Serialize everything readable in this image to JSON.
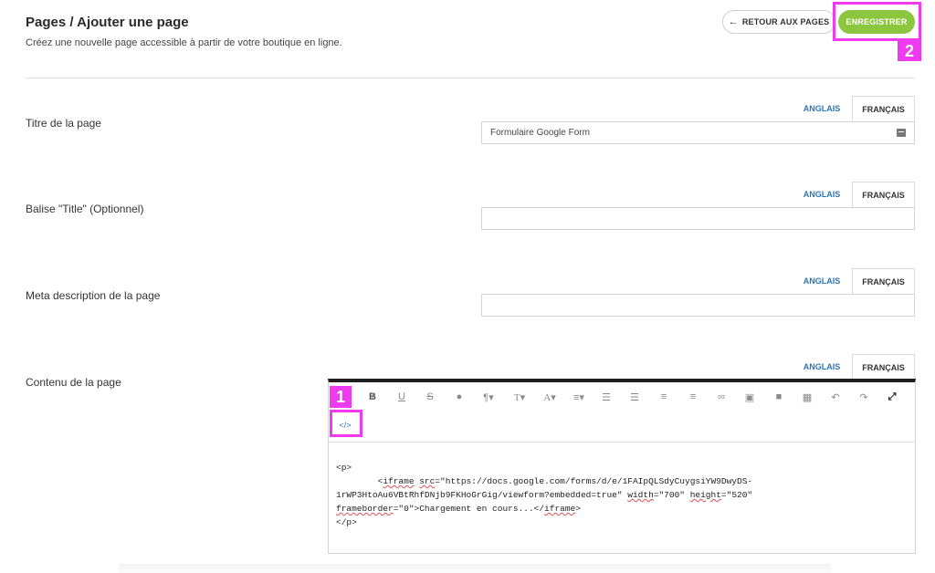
{
  "header": {
    "title": "Pages / Ajouter une page",
    "subtitle": "Créez une nouvelle page accessible à partir de votre boutique en ligne.",
    "back_label": "RETOUR AUX PAGES",
    "save_label": "ENREGISTRER"
  },
  "badges": {
    "one": "1",
    "two": "2"
  },
  "languages": {
    "en": "ANGLAIS",
    "fr": "FRANÇAIS"
  },
  "fields": {
    "page_title": {
      "label": "Titre de la page",
      "value": "Formulaire Google Form"
    },
    "title_tag": {
      "label": "Balise \"Title\" (Optionnel)",
      "value": ""
    },
    "meta_description": {
      "label": "Meta description de la page",
      "value": ""
    },
    "content": {
      "label": "Contenu de la page"
    }
  },
  "editor": {
    "code": {
      "line1": "<p>",
      "line2_indent": "        <",
      "line2_tag": "iframe",
      "line2_sp": " ",
      "line2_attr": "src",
      "line2_rest": "=\"https://docs.google.com/forms/d/e/1FAIpQLSdyCuygsiYW9DwyDS-",
      "line3": "1rWP3HtoAu6VBtRhfDNjb9FKHoGrGig/viewform?embedded=true\" ",
      "line3_attr1": "width",
      "line3_mid": "=\"700\" ",
      "line3_attr2": "height",
      "line3_end": "=\"520\"",
      "line4_attr": "frameborder",
      "line4_mid": "=\"0\">Chargement en cours...</",
      "line4_tag": "iframe",
      "line4_end": ">",
      "line5": "</p>"
    }
  },
  "colors": {
    "accent_green": "#8cc63f",
    "link_blue": "#2a76b8",
    "highlight_magenta": "#ee3bee"
  }
}
